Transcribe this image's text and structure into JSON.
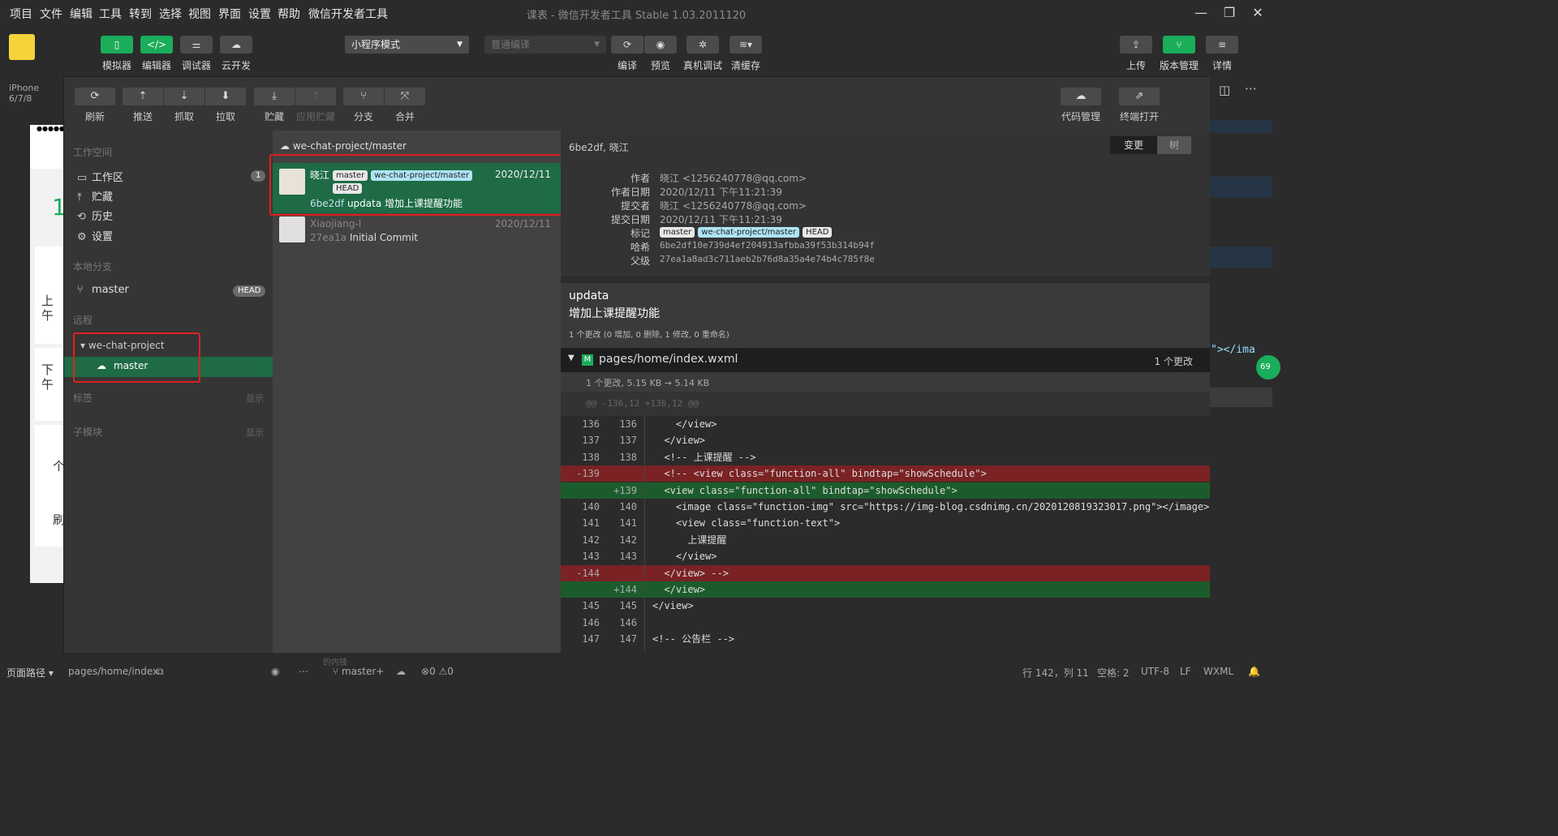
{
  "menubar": {
    "items": [
      "项目",
      "文件",
      "编辑",
      "工具",
      "转到",
      "选择",
      "视图",
      "界面",
      "设置",
      "帮助",
      "微信开发者工具"
    ],
    "title": "课表 - 微信开发者工具 Stable 1.03.2011120"
  },
  "toolbar": {
    "left": [
      "模拟器",
      "编辑器",
      "调试器",
      "云开发"
    ],
    "mode": "小程序模式",
    "compile_placeholder": "普通编译",
    "center": [
      "编译",
      "预览",
      "真机调试",
      "清缓存"
    ],
    "right": [
      "上传",
      "版本管理",
      "详情"
    ]
  },
  "device": "iPhone 6/7/8",
  "sim_texts": [
    "1",
    "上",
    "午",
    "下",
    "午",
    "个",
    "刷"
  ],
  "vc": {
    "buttons": [
      "刷新",
      "推送",
      "抓取",
      "拉取",
      "贮藏",
      "应用贮藏",
      "分支",
      "合并"
    ],
    "right": [
      "代码管理",
      "终端打开"
    ]
  },
  "sidebar": {
    "workspace_title": "工作空间",
    "workspace": [
      {
        "label": "工作区",
        "badge": "1"
      },
      {
        "label": "贮藏"
      },
      {
        "label": "历史"
      },
      {
        "label": "设置"
      }
    ],
    "local_title": "本地分支",
    "local_branch": "master",
    "head": "HEAD",
    "remote_title": "远程",
    "remote_name": "we-chat-project",
    "remote_branch": "master",
    "tags_title": "标签",
    "tags_show": "显示",
    "sub_title": "子模块",
    "sub_show": "显示"
  },
  "commits": {
    "branch_header": "we-chat-project/master",
    "list": [
      {
        "author": "晓江",
        "tags": [
          "master",
          "we-chat-project/master",
          "HEAD"
        ],
        "date": "2020/12/11",
        "hash": "6be2df",
        "message": "updata 增加上课提醒功能"
      },
      {
        "author": "Xiaojiang-l",
        "date": "2020/12/11",
        "hash": "27ea1a",
        "message": "Initial Commit"
      }
    ]
  },
  "detail": {
    "header": "6be2df, 晓江",
    "tabs": [
      "变更",
      "树"
    ],
    "meta": [
      {
        "k": "作者",
        "v": "晓江 <1256240778@qq.com>"
      },
      {
        "k": "作者日期",
        "v": "2020/12/11 下午11:21:39"
      },
      {
        "k": "提交者",
        "v": "晓江 <1256240778@qq.com>"
      },
      {
        "k": "提交日期",
        "v": "2020/12/11 下午11:21:39"
      },
      {
        "k": "标记",
        "v": ""
      },
      {
        "k": "哈希",
        "v": "6be2df10e739d4ef204913afbba39f53b314b94f"
      },
      {
        "k": "父级",
        "v": "27ea1a8ad3c711aeb2b76d8a35a4e74b4c785f8e"
      }
    ],
    "tags": [
      "master",
      "we-chat-project/master",
      "HEAD"
    ],
    "msg_title": "updata",
    "msg_body": "增加上课提醒功能",
    "summary": "1 个更改 (0 增加, 0 删除, 1 修改, 0 重命名)",
    "file": {
      "status": "M",
      "path": "pages/home/index.wxml",
      "count": "1 个更改"
    },
    "file_size": "1 个更改, 5.15 KB → 5.14 KB",
    "hunk": "@@ -136,12 +136,12 @@",
    "lines": [
      {
        "a": "136",
        "b": "136",
        "t": "",
        "c": "    </view>"
      },
      {
        "a": "137",
        "b": "137",
        "t": "",
        "c": "  </view>"
      },
      {
        "a": "138",
        "b": "138",
        "t": "",
        "c": "  <!-- 上课提醒 -->"
      },
      {
        "a": "-139",
        "b": "",
        "t": "del",
        "c": "  <!-- <view class=\"function-all\" bindtap=\"showSchedule\">"
      },
      {
        "a": "",
        "b": "+139",
        "t": "add",
        "c": "  <view class=\"function-all\" bindtap=\"showSchedule\">"
      },
      {
        "a": "140",
        "b": "140",
        "t": "",
        "c": "    <image class=\"function-img\" src=\"https://img-blog.csdnimg.cn/2020120819323017.png\"></image>"
      },
      {
        "a": "141",
        "b": "141",
        "t": "",
        "c": "    <view class=\"function-text\">"
      },
      {
        "a": "142",
        "b": "142",
        "t": "",
        "c": "      上课提醒"
      },
      {
        "a": "143",
        "b": "143",
        "t": "",
        "c": "    </view>"
      },
      {
        "a": "-144",
        "b": "",
        "t": "del",
        "c": "  </view> -->"
      },
      {
        "a": "",
        "b": "+144",
        "t": "add",
        "c": "  </view>"
      },
      {
        "a": "145",
        "b": "145",
        "t": "",
        "c": "</view>"
      },
      {
        "a": "146",
        "b": "146",
        "t": "",
        "c": ""
      },
      {
        "a": "147",
        "b": "147",
        "t": "",
        "c": "<!-- 公告栏 -->"
      }
    ]
  },
  "editor_peek": "\"></ima",
  "editor_badge": "69",
  "status": {
    "path_label": "页面路径",
    "path": "pages/home/index",
    "branch": "master+",
    "errors": "0",
    "warnings": "0",
    "pos": "行 142，列 11",
    "spaces": "空格: 2",
    "enc": "UTF-8",
    "eol": "LF",
    "lang": "WXML",
    "hidden_fragment": "的内技"
  },
  "colors": {
    "green": "#1aad5a",
    "selected_row": "#1e6b45",
    "highlight_box": "#e02020",
    "del": "#7a2224",
    "add": "#1c5c2c"
  }
}
